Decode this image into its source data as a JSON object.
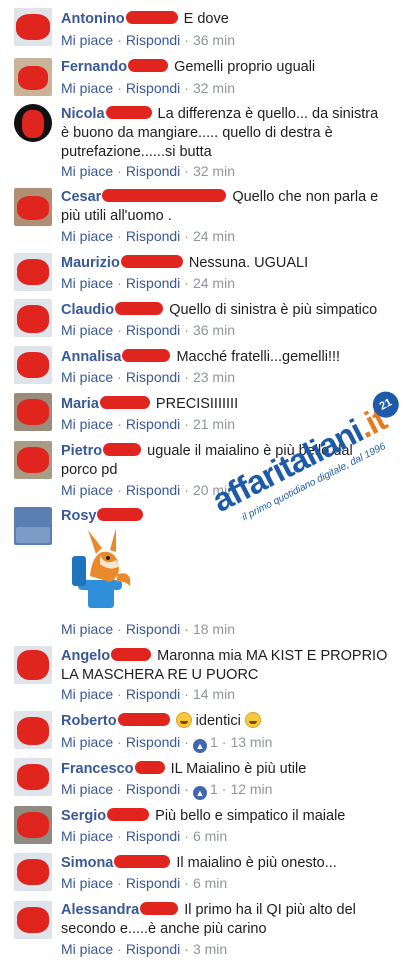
{
  "actions": {
    "like": "Mi piace",
    "reply": "Rispondi"
  },
  "comments": [
    {
      "name": "Antonino",
      "text": "E dove",
      "time": "36 min"
    },
    {
      "name": "Fernando",
      "text": "Gemelli proprio uguali",
      "time": "32 min"
    },
    {
      "name": "Nicola",
      "text": "La differenza è quello... da sinistra",
      "text2": "è buono da mangiare..... quello di destra è",
      "text3": "putrefazione......si butta",
      "time": "32 min"
    },
    {
      "name": "Cesar",
      "text": "Quello che non parla e",
      "text2": "più utili all'uomo .",
      "time": "24 min"
    },
    {
      "name": "Maurizio",
      "text": "Nessuna. UGUALI",
      "time": "24 min"
    },
    {
      "name": "Claudio",
      "text": "Quello di sinistra è più simpatico",
      "time": "36 min"
    },
    {
      "name": "Annalisa",
      "text": "Macché fratelli...gemelli!!!",
      "time": "23 min"
    },
    {
      "name": "Maria",
      "text": "PRECISIIIIIII",
      "time": "21 min"
    },
    {
      "name": "Pietro",
      "text": "uguale il maialino è più bello dal",
      "text2": "porco pd",
      "time": "20 min"
    },
    {
      "name": "Rosy",
      "text": "",
      "time": "18 min"
    },
    {
      "name": "Angelo",
      "text": "Maronna mia MA KIST E PROPRIO",
      "text2": "LA MASCHERA RE U PUORC",
      "time": "14 min"
    },
    {
      "name": "Roberto",
      "text": "identici",
      "time": "13 min",
      "likes": "1"
    },
    {
      "name": "Francesco",
      "text": "IL Maialino è più utile",
      "time": "12 min",
      "likes": "1"
    },
    {
      "name": "Sergio",
      "text": "Più bello e simpatico il maiale",
      "time": "6 min"
    },
    {
      "name": "Simona",
      "text": "Il maialino è più onesto...",
      "time": "6 min"
    },
    {
      "name": "Alessandra",
      "text": "Il primo ha il QI più alto del",
      "text2": "secondo e.....è anche più carino",
      "time": "3 min"
    }
  ],
  "watermark": {
    "brand_a": "affaritaliani",
    "brand_b": ".it",
    "tagline": "il primo quotidiano digitale, dal 1996",
    "badge": "21"
  },
  "colors": {
    "link": "#385898",
    "meta": "#90949c",
    "redaction": "#e0251f"
  }
}
